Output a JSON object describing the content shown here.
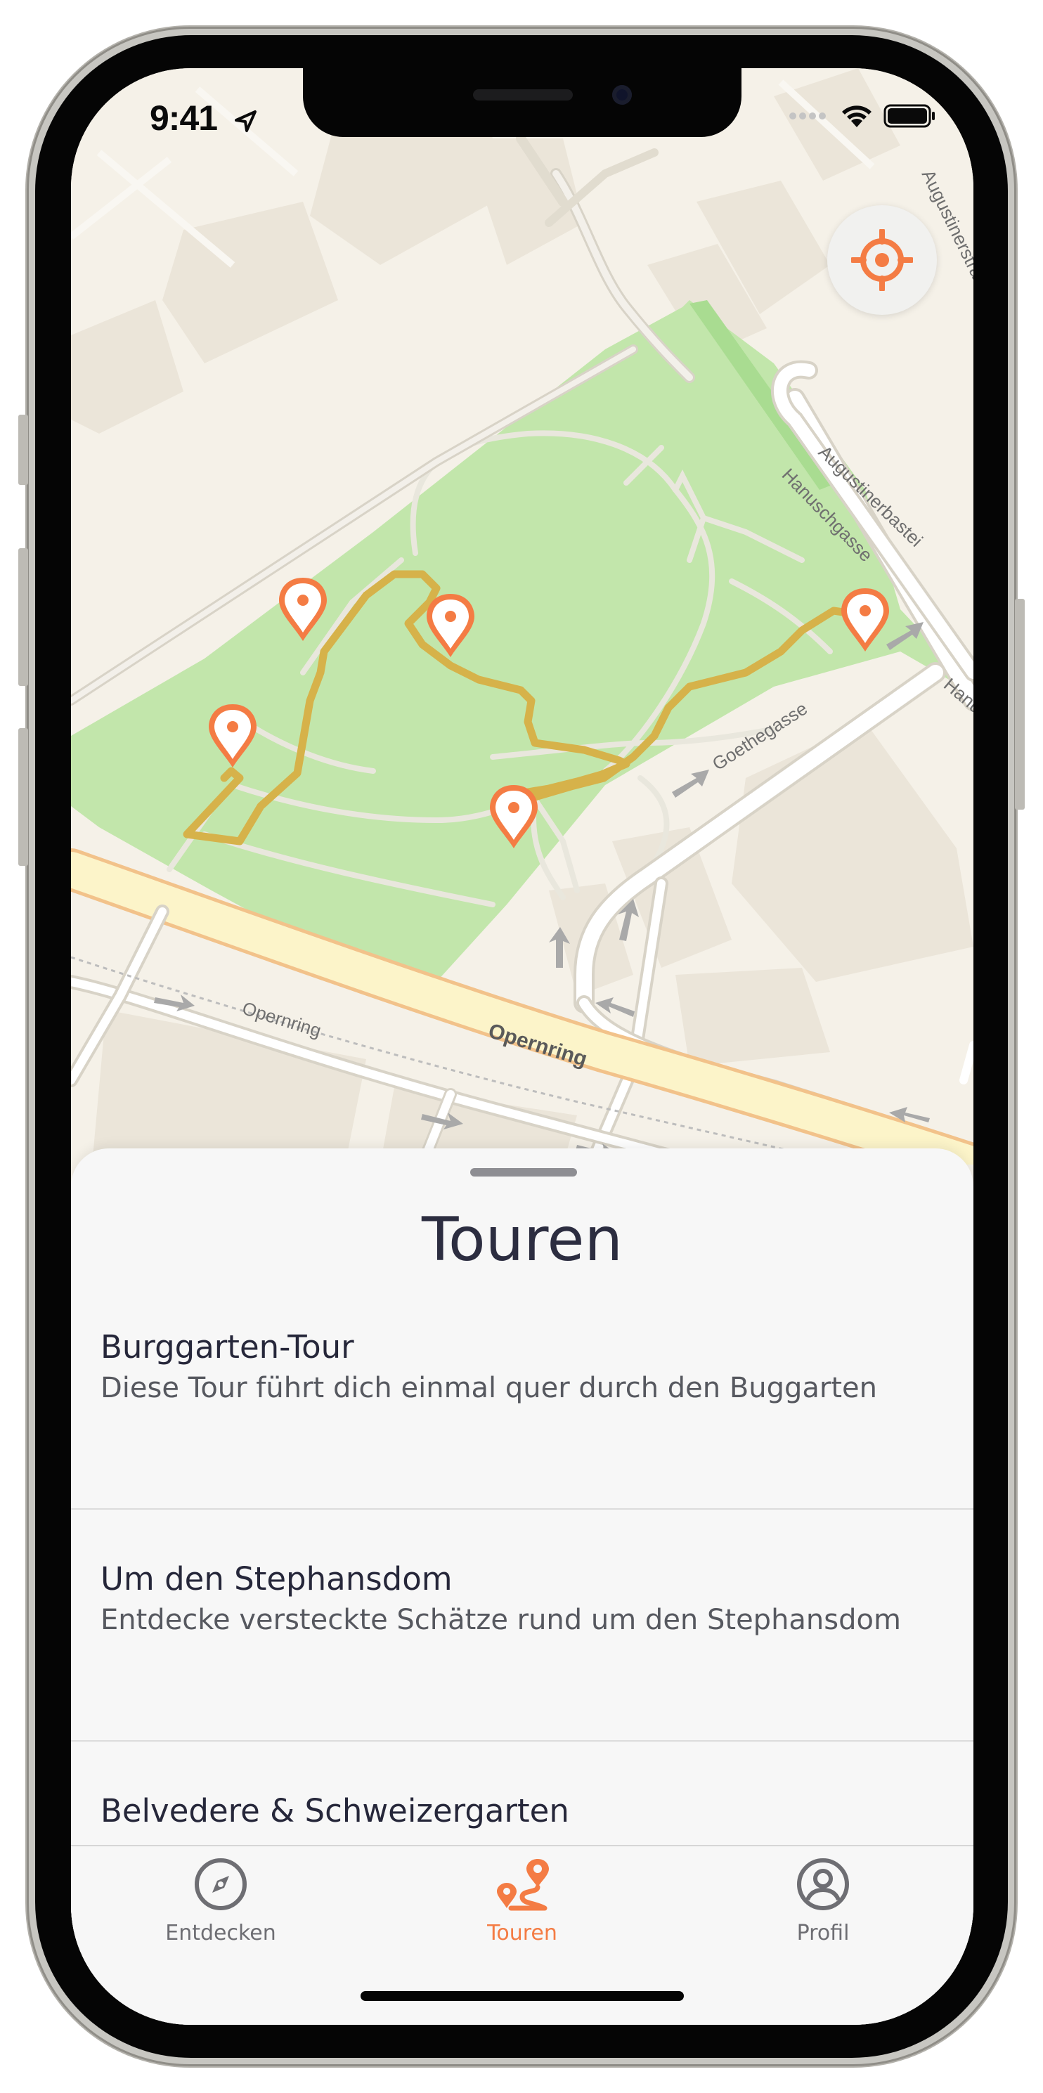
{
  "status": {
    "time": "9:41",
    "icons": [
      "location-arrow-icon",
      "signal-icon",
      "wifi-icon",
      "battery-icon"
    ]
  },
  "map": {
    "street_labels": [
      "Augustinerstraße",
      "Augustinerbastei",
      "Hanuschgasse",
      "Goethegasse",
      "Opernring",
      "Opernring",
      "Hanu"
    ],
    "accent_color": "#f47c44",
    "route_color": "#d6b24a",
    "park_color": "#c2e6ab",
    "icons": [
      "map-pin-icon",
      "locate-crosshair-icon"
    ]
  },
  "sheet": {
    "title": "Touren",
    "tours": [
      {
        "title": "Burggarten-Tour",
        "description": "Diese Tour führt dich einmal quer durch den Buggarten"
      },
      {
        "title": "Um den Stephansdom",
        "description": "Entdecke versteckte Schätze rund um den Stephansdom"
      },
      {
        "title": "Belvedere & Schweizergarten",
        "description": ""
      }
    ]
  },
  "tabbar": {
    "active_color": "#f47c44",
    "items": [
      {
        "label": "Entdecken",
        "icon": "compass-icon"
      },
      {
        "label": "Touren",
        "icon": "route-icon"
      },
      {
        "label": "Profil",
        "icon": "user-circle-icon"
      }
    ]
  }
}
